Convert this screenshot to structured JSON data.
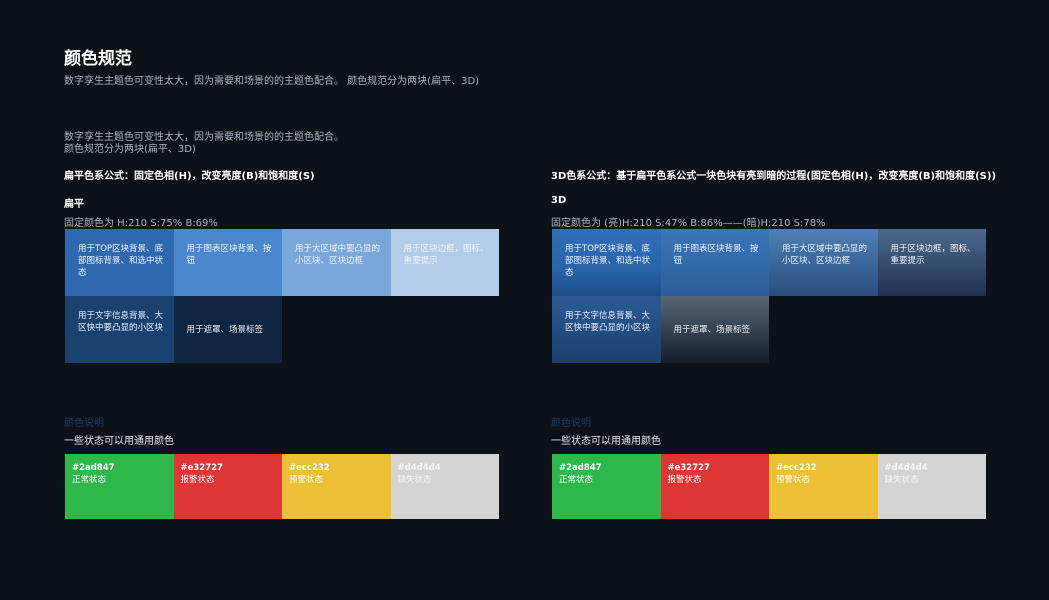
{
  "title": "颜色规范",
  "subtitle": "数字孪生主题色可变性太大，因为需要和场景的的主题色配合。 颜色规范分为两块(扁平、3D)",
  "desc_line1": "数字孪生主题色可变性太大，因为需要和场景的的主题色配合。",
  "desc_line2": "颜色规范分为两块(扁平、3D)",
  "flat": {
    "formula": "扁平色系公式：固定色相(H)，改变亮度(B)和饱和度(S)",
    "heading": "扁平",
    "fixed": "固定颜色为 H:210 S:75% B:69%",
    "cells": [
      {
        "text": "用于TOP区块背景、底部图标背景、和选中状态",
        "color": "#2e69b0"
      },
      {
        "text": "用于图表区块背景、按钮",
        "color": "#4a87cf"
      },
      {
        "text": "用于大区域中要凸显的小区块、区块边框",
        "color": "#7aa7d9"
      },
      {
        "text": "用于区块边框，图标、重要提示",
        "color": "#b3cde9"
      },
      {
        "text": "用于文字信息背景、大区快中要凸显的小区块",
        "color": "#1a4270"
      },
      {
        "text": "用于遮罩、场景标签",
        "color": "#0f2640"
      }
    ]
  },
  "three_d": {
    "formula": "3D色系公式：基于扁平色系公式一块色块有亮到暗的过程(固定色相(H)，改变亮度(B)和饱和度(S))",
    "heading": "3D",
    "fixed": "固定颜色为 (亮)H:210 S:47% B:86%——(暗)H:210 S:78%",
    "cells": [
      {
        "text": "用于TOP区块背景、底部图标背景、和选中状态",
        "gradient": "linear-gradient(180deg,#2f6fba 0%,#2a63a8 60%,#1d4d8a 100%)"
      },
      {
        "text": "用于图表区块背景、按钮",
        "gradient": "linear-gradient(180deg,#3a76bb 0%,#2c5e98 100%)"
      },
      {
        "text": "用于大区域中要凸显的小区块、区块边框",
        "gradient": "linear-gradient(180deg,#4f80b7 0%,#284e7c 100%)"
      },
      {
        "text": "用于区块边框，图标、重要提示",
        "gradient": "linear-gradient(180deg,#4d6a8e 0%,#1f3150 100%)"
      },
      {
        "text": "用于文字信息背景、大区快中要凸显的小区块",
        "gradient": "linear-gradient(180deg,#2b5b95 0%,#1a3f6d 100%)"
      },
      {
        "text": "用于遮罩、场景标签",
        "gradient": "linear-gradient(180deg,#5a6676 0%,#141d2c 100%)"
      }
    ]
  },
  "status": {
    "label": "颜色说明",
    "desc": "一些状态可以用通用颜色",
    "items": [
      {
        "hex": "#2ad847",
        "name": "正常状态",
        "color": "#2fb84a"
      },
      {
        "hex": "#e32727",
        "name": "报警状态",
        "color": "#e03535"
      },
      {
        "hex": "#ecc232",
        "name": "预警状态",
        "color": "#ebc034"
      },
      {
        "hex": "#d4d4d4",
        "name": "缺失状态",
        "color": "#d4d4d4"
      }
    ]
  }
}
